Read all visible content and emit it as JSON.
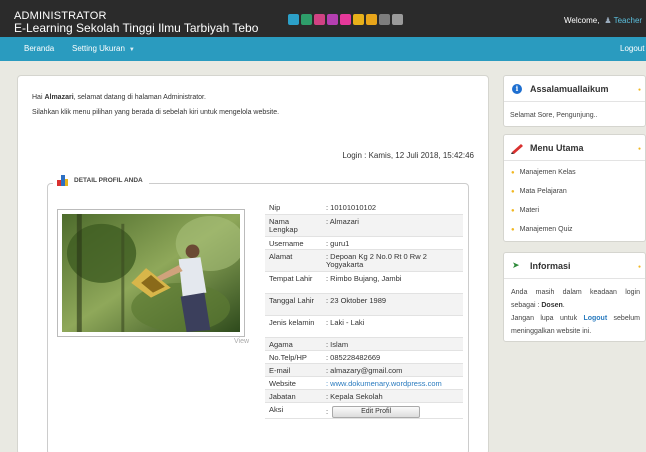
{
  "header": {
    "title_line1": "ADMINISTRATOR",
    "title_line2": "E-Learning Sekolah Tinggi Ilmu Tarbiyah Tebo",
    "theme_colors": [
      "#2ca0c8",
      "#2e9e6a",
      "#d04283",
      "#b43fb0",
      "#e6399b",
      "#e8b11a",
      "#e8a51a",
      "#7d7d7d",
      "#9a9a9a"
    ],
    "welcome_text": "Welcome,",
    "user_name": "Teacher"
  },
  "nav": {
    "home": "Beranda",
    "setting": "Setting Ukuran",
    "logout": "Logout"
  },
  "main": {
    "greeting_prefix": "Hai ",
    "greeting_name": "Almazari",
    "greeting_suffix": ", selamat datang di halaman Administrator.",
    "instruction": "Silahkan klik menu pilihan yang berada di sebelah kiri untuk mengelola website.",
    "login_info": "Login : Kamis, 12 Juli 2018, 15:42:46"
  },
  "profile": {
    "legend": "DETAIL PROFIL ANDA",
    "view_label": "View",
    "edit_button": "Edit Profil",
    "fields": [
      {
        "label": "Nip",
        "value": ": 10101010102"
      },
      {
        "label": "Nama Lengkap",
        "value": ": Almazari"
      },
      {
        "label": "Username",
        "value": ": guru1"
      },
      {
        "label": "Alamat",
        "value": ": Depoan Kg 2 No.0 Rt 0 Rw 2 Yogyakarta"
      },
      {
        "label": "Tempat Lahir",
        "value": ": Rimbo Bujang, Jambi"
      },
      {
        "label": "Tanggal Lahir",
        "value": ": 23 Oktober 1989"
      },
      {
        "label": "Jenis kelamin",
        "value": ": Laki - Laki"
      },
      {
        "label": "Agama",
        "value": ": Islam"
      },
      {
        "label": "No.Telp/HP",
        "value": ": 085228482669"
      },
      {
        "label": "E-mail",
        "value": ": almazary@gmail.com"
      },
      {
        "label": "Website",
        "value": ": www.dokumenary.wordpress.com"
      },
      {
        "label": "Jabatan",
        "value": ": Kepala Sekolah"
      },
      {
        "label": "Aksi",
        "value": ":"
      }
    ]
  },
  "sidebar": {
    "greeting_title": "Assalamuallaikum",
    "greeting_text": "Selamat Sore, Pengunjung..",
    "menu_title": "Menu Utama",
    "menu_items": [
      "Manajemen Kelas",
      "Mata Pelajaran",
      "Materi",
      "Manajemen Quiz"
    ],
    "info_title": "Informasi",
    "info_text1": "Anda masih dalam keadaan login sebagai : ",
    "info_role": "Dosen",
    "info_text2": "Jangan lupa untuk ",
    "info_logout": "Logout",
    "info_text3": " sebelum meninggalkan website ini."
  }
}
